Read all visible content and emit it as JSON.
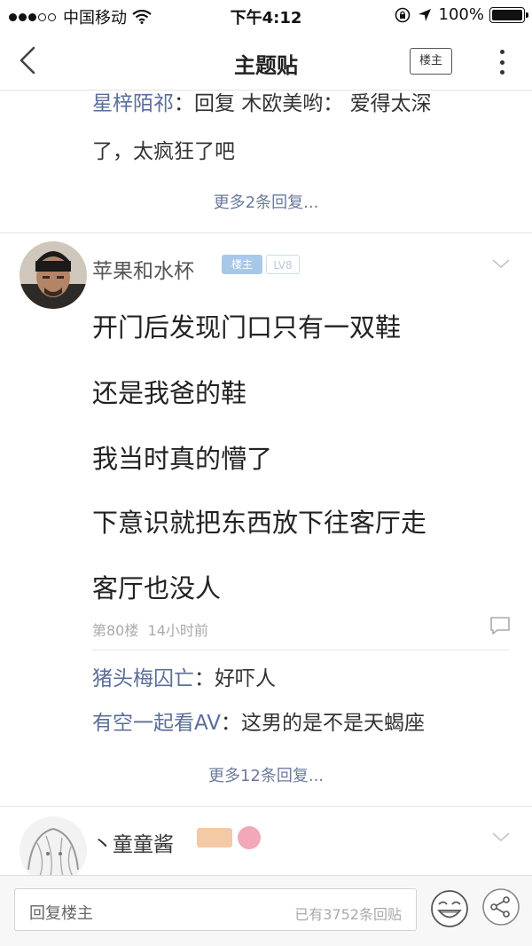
{
  "status_bar": {
    "carrier": "中国移动",
    "time": "下午4:12",
    "battery": "100%"
  },
  "nav": {
    "title": "主题贴",
    "louzhu_button": "楼主"
  },
  "top_reply": {
    "author": "星梓陌祁",
    "text_line1": "：回复 木欧美哟： 爱得太深",
    "text_line2": "了，太疯狂了吧",
    "more": "更多2条回复..."
  },
  "post": {
    "author": "苹果和水杯",
    "badge_owner": "楼主",
    "badge_level": "LV8",
    "lines": [
      "开门后发现门口只有一双鞋",
      "还是我爸的鞋",
      "我当时真的懵了",
      "下意识就把东西放下往客厅走",
      "客厅也没人"
    ],
    "floor": "第80楼",
    "time_ago": "14小时前",
    "replies": [
      {
        "author": "猪头梅囚亡",
        "text": "：好吓人"
      },
      {
        "author": "有空一起看AV",
        "text": "：这男的是不是天蝎座"
      }
    ],
    "more": "更多12条回复..."
  },
  "next_post": {
    "author": "丶童童酱"
  },
  "bottom_bar": {
    "placeholder": "回复楼主",
    "reply_count": "已有3752条回贴"
  },
  "colors": {
    "username": "#5a6e9a",
    "owner_badge": "#a8c8ea"
  }
}
